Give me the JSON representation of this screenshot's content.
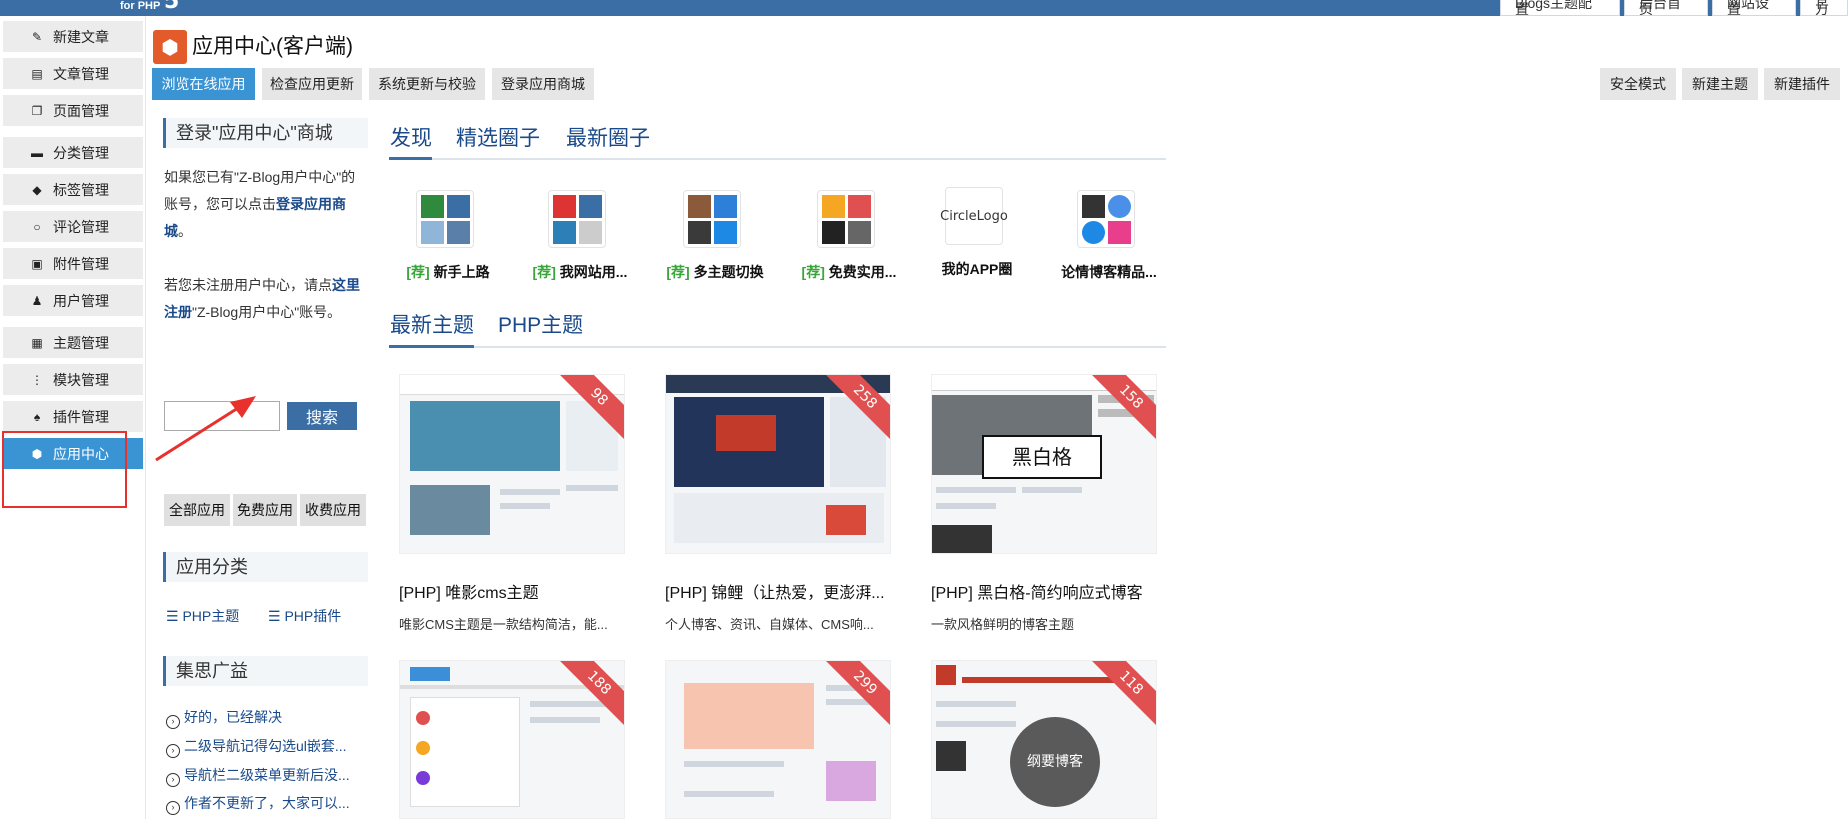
{
  "topbar": {
    "logo_sub": "for PHP",
    "logo_mark": "5",
    "tabs": [
      "Blogs主题配置",
      "后台首页",
      "网站设置",
      "官方"
    ]
  },
  "sidebar": {
    "items": [
      {
        "label": "新建文章",
        "icon": "edit-icon"
      },
      {
        "label": "文章管理",
        "icon": "document-icon"
      },
      {
        "label": "页面管理",
        "icon": "pages-icon"
      },
      {
        "label": "分类管理",
        "icon": "folder-icon"
      },
      {
        "label": "标签管理",
        "icon": "tag-icon"
      },
      {
        "label": "评论管理",
        "icon": "comment-icon"
      },
      {
        "label": "附件管理",
        "icon": "attachment-icon"
      },
      {
        "label": "用户管理",
        "icon": "user-icon"
      },
      {
        "label": "主题管理",
        "icon": "theme-icon"
      },
      {
        "label": "模块管理",
        "icon": "module-icon"
      },
      {
        "label": "插件管理",
        "icon": "plugin-icon"
      },
      {
        "label": "应用中心",
        "icon": "cube-icon",
        "active": true
      }
    ]
  },
  "header": {
    "title": "应用中心(客户端)",
    "tabs": [
      "浏览在线应用",
      "检查应用更新",
      "系统更新与校验",
      "登录应用商城"
    ],
    "right_buttons": [
      "安全模式",
      "新建主题",
      "新建插件"
    ]
  },
  "left": {
    "login_head": "登录\"应用中心\"商城",
    "login_p1_a": "如果您已有\"Z-Blog用户中心\"的账号，您可以点击",
    "login_p1_link": "登录应用商城",
    "login_p1_b": "。",
    "login_p2_a": "若您未注册用户中心，请点",
    "login_p2_link": "这里注册",
    "login_p2_b": "\"Z-Blog用户中心\"账号。",
    "search_button": "搜索",
    "filters": [
      "全部应用",
      "免费应用",
      "收费应用"
    ],
    "cat_head": "应用分类",
    "cats": [
      "PHP主题",
      "PHP插件"
    ],
    "news_head": "集思广益",
    "news": [
      "好的，已经解决",
      "二级导航记得勾选ul嵌套...",
      "导航栏二级菜单更新后没...",
      "作者不更新了，大家可以..."
    ]
  },
  "discover": {
    "tabs": [
      "发现",
      "精选圈子",
      "最新圈子"
    ],
    "circles": [
      {
        "rec": "[荐]",
        "name": "新手上路"
      },
      {
        "rec": "[荐]",
        "name": "我网站用..."
      },
      {
        "rec": "[荐]",
        "name": "多主题切换"
      },
      {
        "rec": "[荐]",
        "name": "免费实用..."
      },
      {
        "rec": "",
        "name": "我的APP圈",
        "alt": "CircleLogo"
      },
      {
        "rec": "",
        "name": "论情博客精品..."
      }
    ]
  },
  "themes": {
    "tabs": [
      "最新主题",
      "PHP主题"
    ],
    "cards": [
      {
        "count": "98",
        "title": "[PHP] 唯影cms主题",
        "desc": "唯影CMS主题是一款结构简洁，能..."
      },
      {
        "count": "258",
        "title": "[PHP] 锦鲤（让热爱，更澎湃...",
        "desc": "个人博客、资讯、自媒体、CMS响..."
      },
      {
        "count": "158",
        "title": "[PHP] 黑白格-简约响应式博客",
        "desc": "一款风格鲜明的博客主题",
        "overlay": "黑白格"
      },
      {
        "count": "188",
        "title": "",
        "desc": ""
      },
      {
        "count": "299",
        "title": "",
        "desc": ""
      },
      {
        "count": "118",
        "title": "",
        "desc": "",
        "overlay": "纲要博客"
      }
    ]
  },
  "colors": {
    "accent": "#3a94d4",
    "brand": "#3a6ea5",
    "ribbon": "#e05050",
    "annotation": "#e8312c"
  }
}
